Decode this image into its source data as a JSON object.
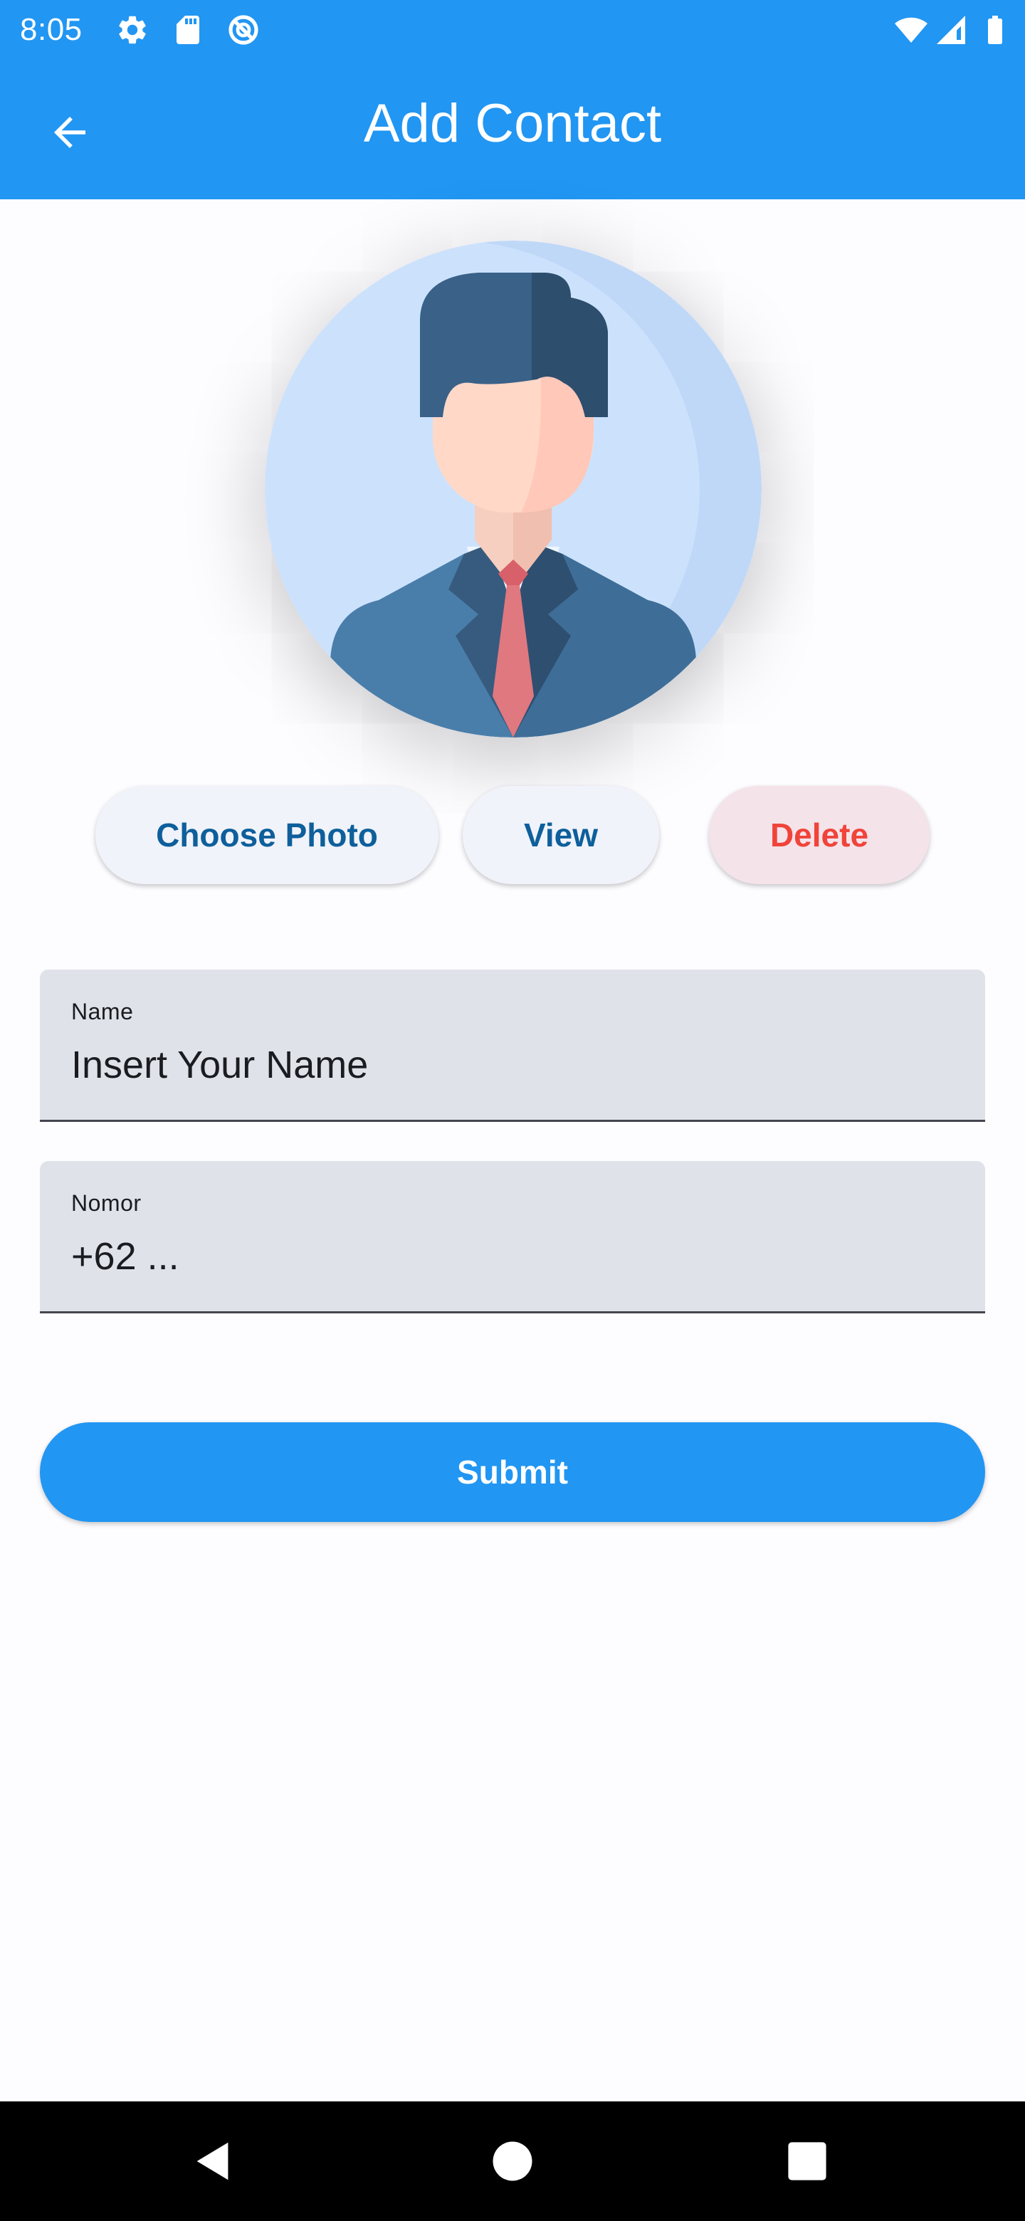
{
  "status_bar": {
    "time": "8:05",
    "left_icons": [
      "settings-icon",
      "sd-card-icon",
      "do-not-disturb-icon"
    ],
    "right_icons": [
      "wifi-icon",
      "cellular-signal-icon",
      "battery-icon"
    ]
  },
  "app_bar": {
    "title": "Add Contact",
    "back_icon": "arrow-left-icon",
    "color": "#2196F3"
  },
  "avatar": {
    "icon": "person-avatar-icon"
  },
  "photo_actions": {
    "choose_label": "Choose Photo",
    "view_label": "View",
    "delete_label": "Delete"
  },
  "form": {
    "name": {
      "label": "Name",
      "placeholder": "Insert Your Name",
      "value": ""
    },
    "number": {
      "label": "Nomor",
      "placeholder": "+62 ...",
      "value": ""
    },
    "submit_label": "Submit"
  },
  "nav_bar": {
    "icons": [
      "nav-back-icon",
      "nav-home-icon",
      "nav-recents-icon"
    ]
  },
  "colors": {
    "primary": "#2196F3",
    "delete_text": "#F0443A",
    "action_text": "#0E5F9B",
    "field_bg": "#E0E2EA"
  }
}
